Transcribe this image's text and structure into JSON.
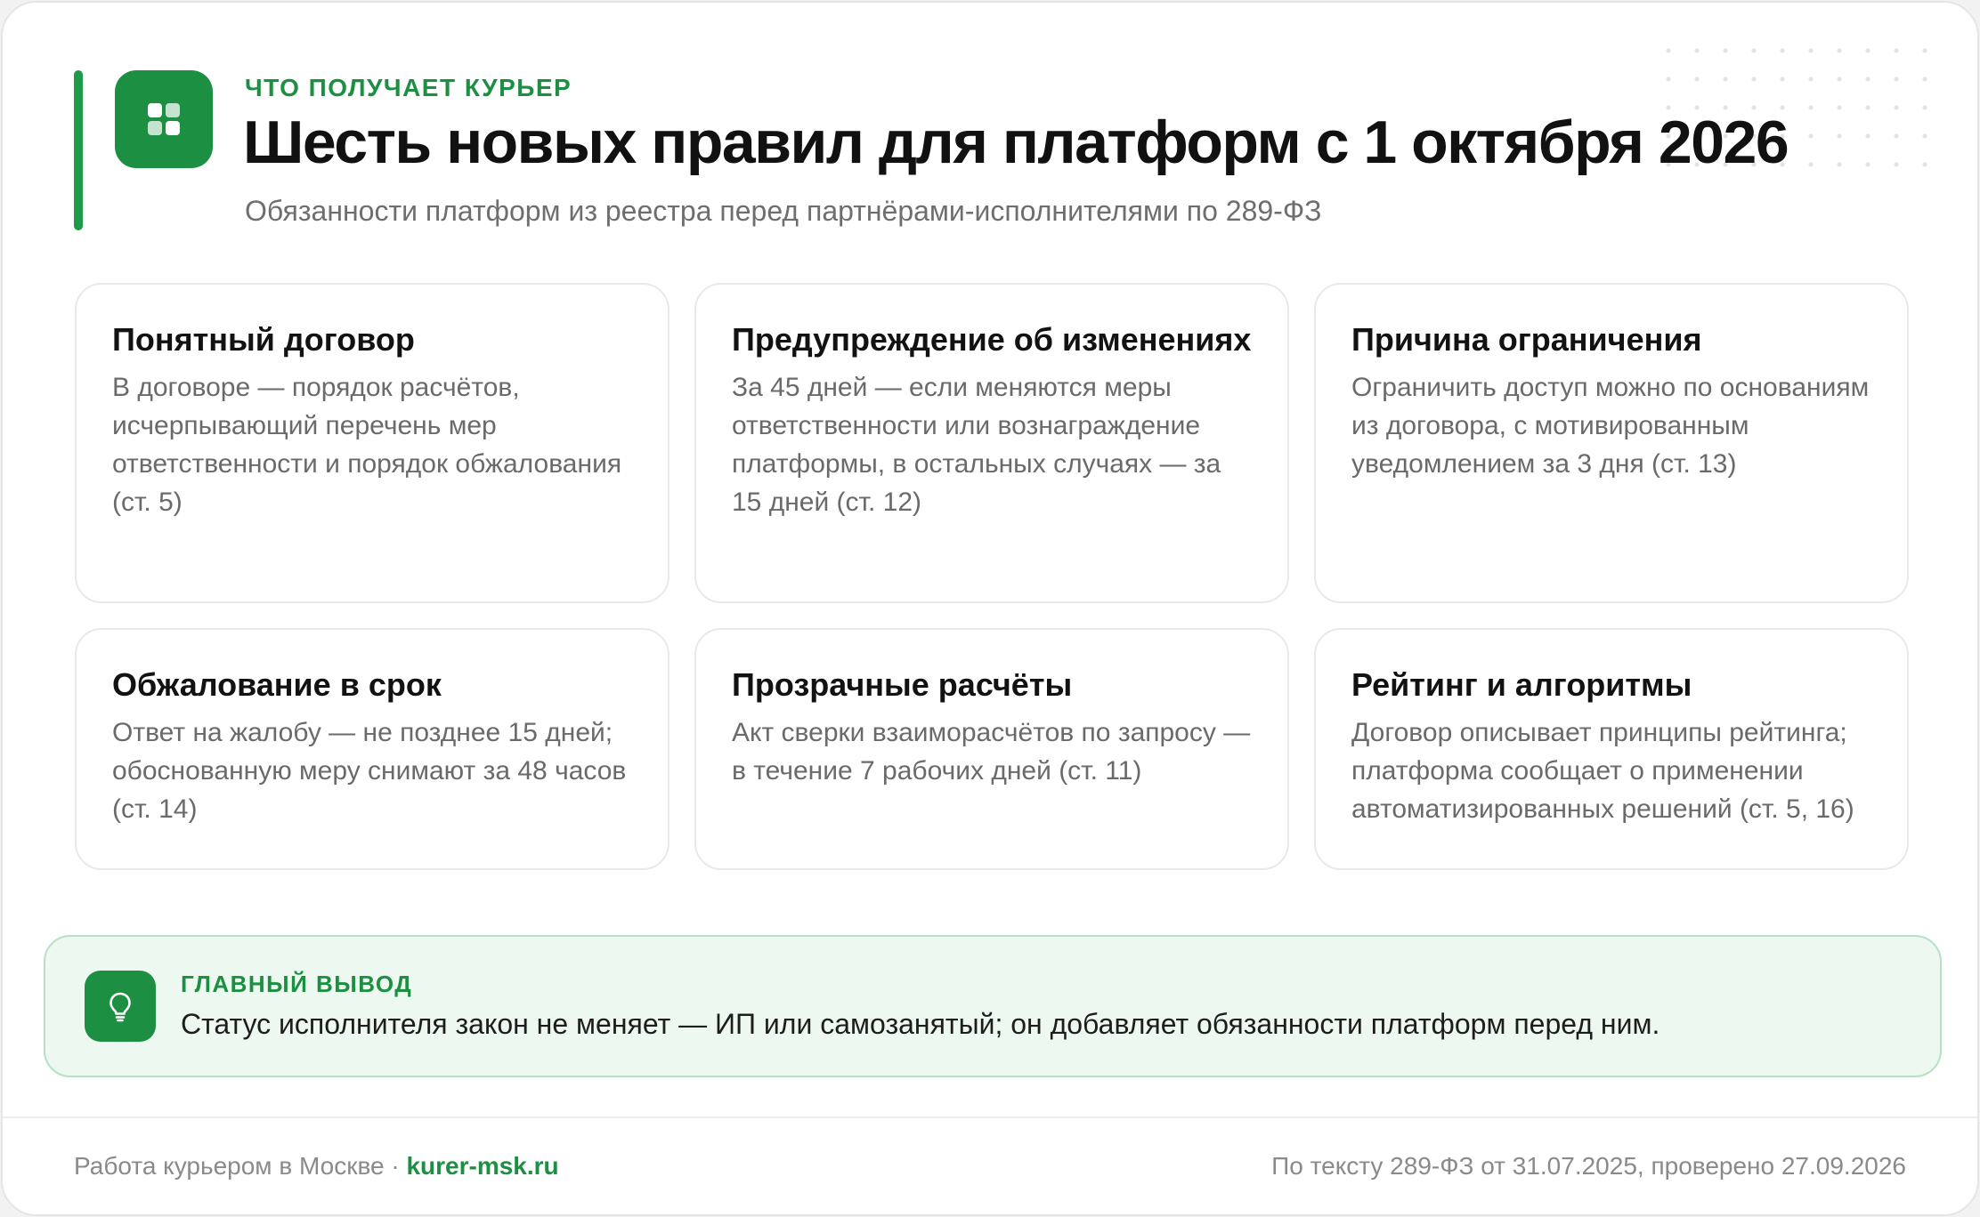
{
  "header": {
    "kicker": "ЧТО ПОЛУЧАЕТ КУРЬЕР",
    "title": "Шесть новых правил для платформ с 1 октября 2026",
    "subtitle": "Обязанности платформ из реестра перед партнёрами-исполнителями по 289-ФЗ",
    "logo_icon": "grid-icon"
  },
  "cards": [
    {
      "title": "Понятный договор",
      "text": "В договоре — порядок расчётов, исчерпывающий перечень мер ответственности и порядок обжалования (ст. 5)"
    },
    {
      "title": "Предупреждение об изменениях",
      "text": "За 45 дней — если меняются меры ответственности или вознаграждение платформы, в остальных случаях — за 15 дней (ст. 12)"
    },
    {
      "title": "Причина ограничения",
      "text": "Ограничить доступ можно по основаниям из договора, с мотивированным уведомлением за 3 дня (ст. 13)"
    },
    {
      "title": "Обжалование в срок",
      "text": "Ответ на жалобу — не позднее 15 дней; обоснованную меру снимают за 48 часов (ст. 14)"
    },
    {
      "title": "Прозрачные расчёты",
      "text": "Акт сверки взаиморасчётов по запросу — в течение 7 рабочих дней (ст. 11)"
    },
    {
      "title": "Рейтинг и алгоритмы",
      "text": "Договор описывает принципы рейтинга; платформа сообщает о применении автоматизированных решений (ст. 5, 16)"
    }
  ],
  "conclusion": {
    "label": "ГЛАВНЫЙ ВЫВОД",
    "text": "Статус исполнителя закон не меняет — ИП или самозанятый; он добавляет обязанности платформ перед ним.",
    "icon": "lightbulb-icon"
  },
  "footer": {
    "left_text": "Работа курьером в Москве · ",
    "site": "kurer-msk.ru",
    "right_text": "По тексту 289-ФЗ от 31.07.2025, проверено 27.09.2026"
  },
  "colors": {
    "accent": "#1c8f42",
    "conclusion_bg": "#edf8f0",
    "conclusion_border": "#b6e1c3"
  }
}
